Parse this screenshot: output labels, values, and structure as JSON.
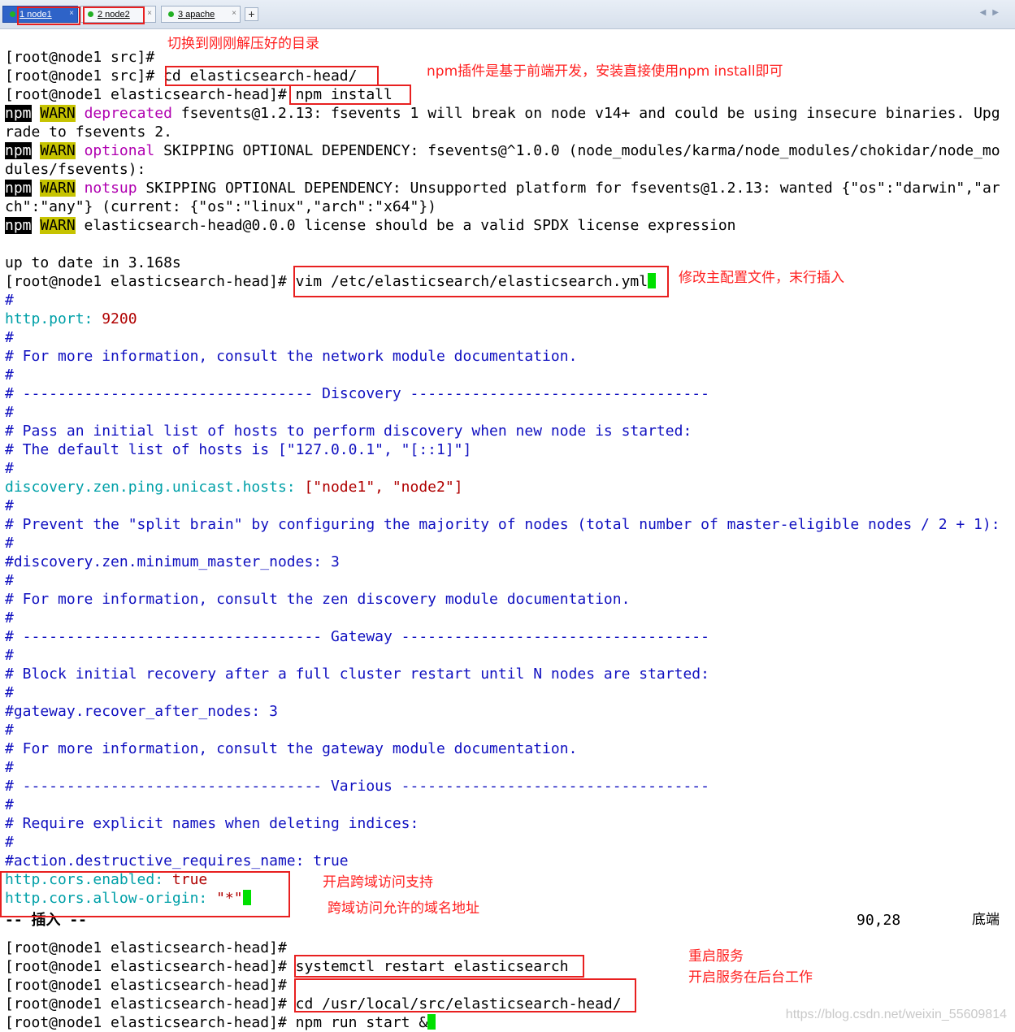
{
  "tabs": [
    {
      "label": "1 node1",
      "close": "×"
    },
    {
      "label": "2 node2",
      "close": "×"
    },
    {
      "label": "3 apache",
      "close": "×"
    }
  ],
  "tab_add": "+",
  "tab_scroll": "◀▶",
  "terminal": {
    "l1": "[root@node1 src]#",
    "l2": "[root@node1 src]# cd elasticsearch-head/",
    "l3": "[root@node1 elasticsearch-head]# npm install",
    "npm": "npm",
    "warn": "WARN",
    "l4_tag": "deprecated",
    "l4_text": " fsevents@1.2.13: fsevents 1 will break on node v14+ and could be using insecure binaries. Upg",
    "l5": "rade to fsevents 2.",
    "l6_tag": "optional",
    "l6_text": " SKIPPING OPTIONAL DEPENDENCY: fsevents@^1.0.0 (node_modules/karma/node_modules/chokidar/node_mo",
    "l7": "dules/fsevents):",
    "l8_tag": "notsup",
    "l8_text": " SKIPPING OPTIONAL DEPENDENCY: Unsupported platform for fsevents@1.2.13: wanted {\"os\":\"darwin\",\"ar",
    "l9": "ch\":\"any\"} (current: {\"os\":\"linux\",\"arch\":\"x64\"})",
    "l10_text": " elasticsearch-head@0.0.0 license should be a valid SPDX license expression",
    "l12": "up to date in 3.168s",
    "l13": "[root@node1 elasticsearch-head]# vim /etc/elasticsearch/elasticsearch.yml",
    "hash": "#",
    "port_key": "http.port:",
    "port_val": " 9200",
    "c_more_network": "# For more information, consult the network module documentation.",
    "c_disc_left": "# --------------------------------- ",
    "c_disc_word": "Discovery",
    "c_disc_right": " ----------------------------------",
    "c_pass": "# Pass an initial list of hosts to perform discovery when new node is started:",
    "c_default": "# The default list of hosts is [\"127.0.0.1\", \"[::1]\"]",
    "hosts_key": "discovery.zen.ping.unicast.hosts:",
    "hosts_val": " [\"node1\", \"node2\"]",
    "c_prevent": "# Prevent the \"split brain\" by configuring the majority of nodes (total number of master-eligible nodes / 2 + 1):",
    "c_min_master": "#discovery.zen.minimum_master_nodes: 3",
    "c_more_zen": "# For more information, consult the zen discovery module documentation.",
    "c_gw_left": "# ---------------------------------- ",
    "c_gw_word": "Gateway",
    "c_gw_right": " -----------------------------------",
    "c_block": "# Block initial recovery after a full cluster restart until N nodes are started:",
    "c_recover": "#gateway.recover_after_nodes: 3",
    "c_more_gw": "# For more information, consult the gateway module documentation.",
    "c_var_left": "# ---------------------------------- ",
    "c_var_word": "Various",
    "c_var_right": " -----------------------------------",
    "c_require": "# Require explicit names when deleting indices:",
    "c_destructive": "#action.destructive_requires_name: true",
    "cors_en_key": "http.cors.enabled:",
    "cors_en_val": " true",
    "cors_origin_key": "http.cors.allow-origin:",
    "cors_origin_val": " \"*\"",
    "mode": "-- 插入 --",
    "pos": "90,28",
    "scroll": "底端",
    "p1": "[root@node1 elasticsearch-head]#",
    "p2": "[root@node1 elasticsearch-head]# systemctl restart elasticsearch",
    "p3": "[root@node1 elasticsearch-head]#",
    "p4": "[root@node1 elasticsearch-head]# cd /usr/local/src/elasticsearch-head/",
    "p5": "[root@node1 elasticsearch-head]# npm run start &"
  },
  "annotations": {
    "switch_dir": "切换到刚刚解压好的目录",
    "npm_note": "npm插件是基于前端开发，安装直接使用npm install即可",
    "edit_config": "修改主配置文件，末行插入",
    "enable_cors": "开启跨域访问支持",
    "cors_origin": "跨域访问允许的域名地址",
    "restart": "重启服务",
    "background": "开启服务在后台工作"
  },
  "watermark": "https://blog.csdn.net/weixin_55609814",
  "colors": {
    "annotation": "#ff2020",
    "cursor": "#00e000",
    "warn_bg": "#c6c300",
    "key": "#00a0a8",
    "value": "#b00000"
  }
}
